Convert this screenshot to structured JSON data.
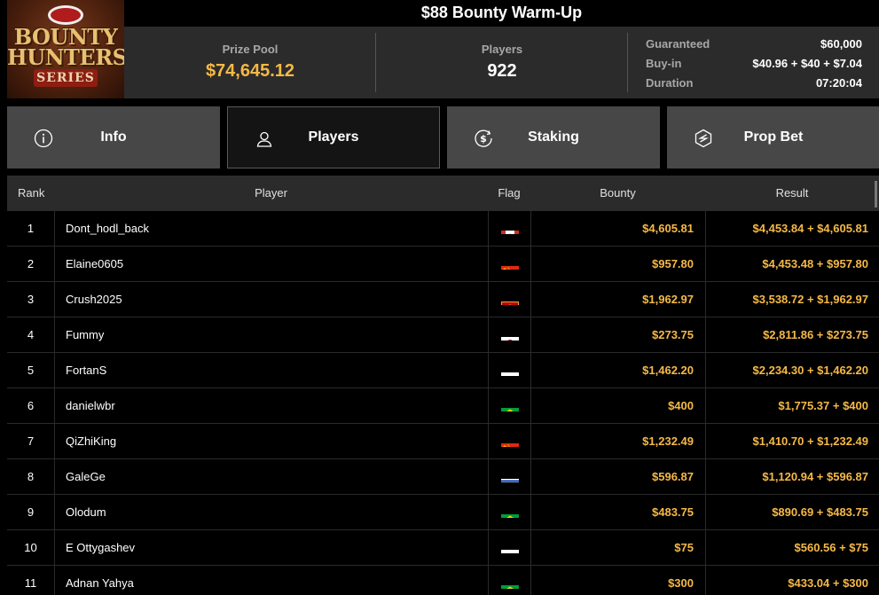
{
  "brand": {
    "logo_line1": "BOUNTY",
    "logo_line2": "HUNTERS",
    "logo_line3": "SERIES"
  },
  "tournament": {
    "title": "$88 Bounty Warm-Up",
    "prize_pool_label": "Prize Pool",
    "prize_pool_value": "$74,645.12",
    "players_label": "Players",
    "players_value": "922",
    "details": [
      {
        "label": "Guaranteed",
        "value": "$60,000"
      },
      {
        "label": "Buy-in",
        "value": "$40.96 + $40 + $7.04"
      },
      {
        "label": "Duration",
        "value": "07:20:04"
      }
    ]
  },
  "tabs": [
    {
      "label": "Info",
      "icon": "info-icon",
      "active": false
    },
    {
      "label": "Players",
      "icon": "user-icon",
      "active": true
    },
    {
      "label": "Staking",
      "icon": "dollar-icon",
      "active": false
    },
    {
      "label": "Prop Bet",
      "icon": "prop-bet-icon",
      "active": false
    }
  ],
  "table": {
    "headers": {
      "rank": "Rank",
      "player": "Player",
      "flag": "Flag",
      "bounty": "Bounty",
      "result": "Result"
    },
    "rows": [
      {
        "rank": "1",
        "player": "Dont_hodl_back",
        "flag": "canada-flag",
        "bounty": "$4,605.81",
        "result": "$4,453.84 + $4,605.81"
      },
      {
        "rank": "2",
        "player": "Elaine0605",
        "flag": "china-flag",
        "bounty": "$957.80",
        "result": "$4,453.48 + $957.80"
      },
      {
        "rank": "3",
        "player": "Crush2025",
        "flag": "montenegro-flag",
        "bounty": "$1,962.97",
        "result": "$3,538.72 + $1,962.97"
      },
      {
        "rank": "4",
        "player": "Fummy",
        "flag": "japan-flag",
        "bounty": "$273.75",
        "result": "$2,811.86 + $273.75"
      },
      {
        "rank": "5",
        "player": "FortanS",
        "flag": "russia-flag",
        "bounty": "$1,462.20",
        "result": "$2,234.30 + $1,462.20"
      },
      {
        "rank": "6",
        "player": "danielwbr",
        "flag": "brazil-flag",
        "bounty": "$400",
        "result": "$1,775.37 + $400"
      },
      {
        "rank": "7",
        "player": "QiZhiKing",
        "flag": "china-flag",
        "bounty": "$1,232.49",
        "result": "$1,410.70 + $1,232.49"
      },
      {
        "rank": "8",
        "player": "GaleGe",
        "flag": "israel-flag",
        "bounty": "$596.87",
        "result": "$1,120.94 + $596.87"
      },
      {
        "rank": "9",
        "player": "Olodum",
        "flag": "brazil-flag",
        "bounty": "$483.75",
        "result": "$890.69 + $483.75"
      },
      {
        "rank": "10",
        "player": "E Ottygashev",
        "flag": "russia-flag",
        "bounty": "$75",
        "result": "$560.56 + $75"
      },
      {
        "rank": "11",
        "player": "Adnan Yahya",
        "flag": "brazil-flag",
        "bounty": "$300",
        "result": "$433.04 + $300"
      }
    ]
  },
  "colors": {
    "accent_gold": "#f6b946",
    "panel_bg": "#2b2b2b",
    "tab_bg": "#474747",
    "tab_active_bg": "#141414"
  }
}
